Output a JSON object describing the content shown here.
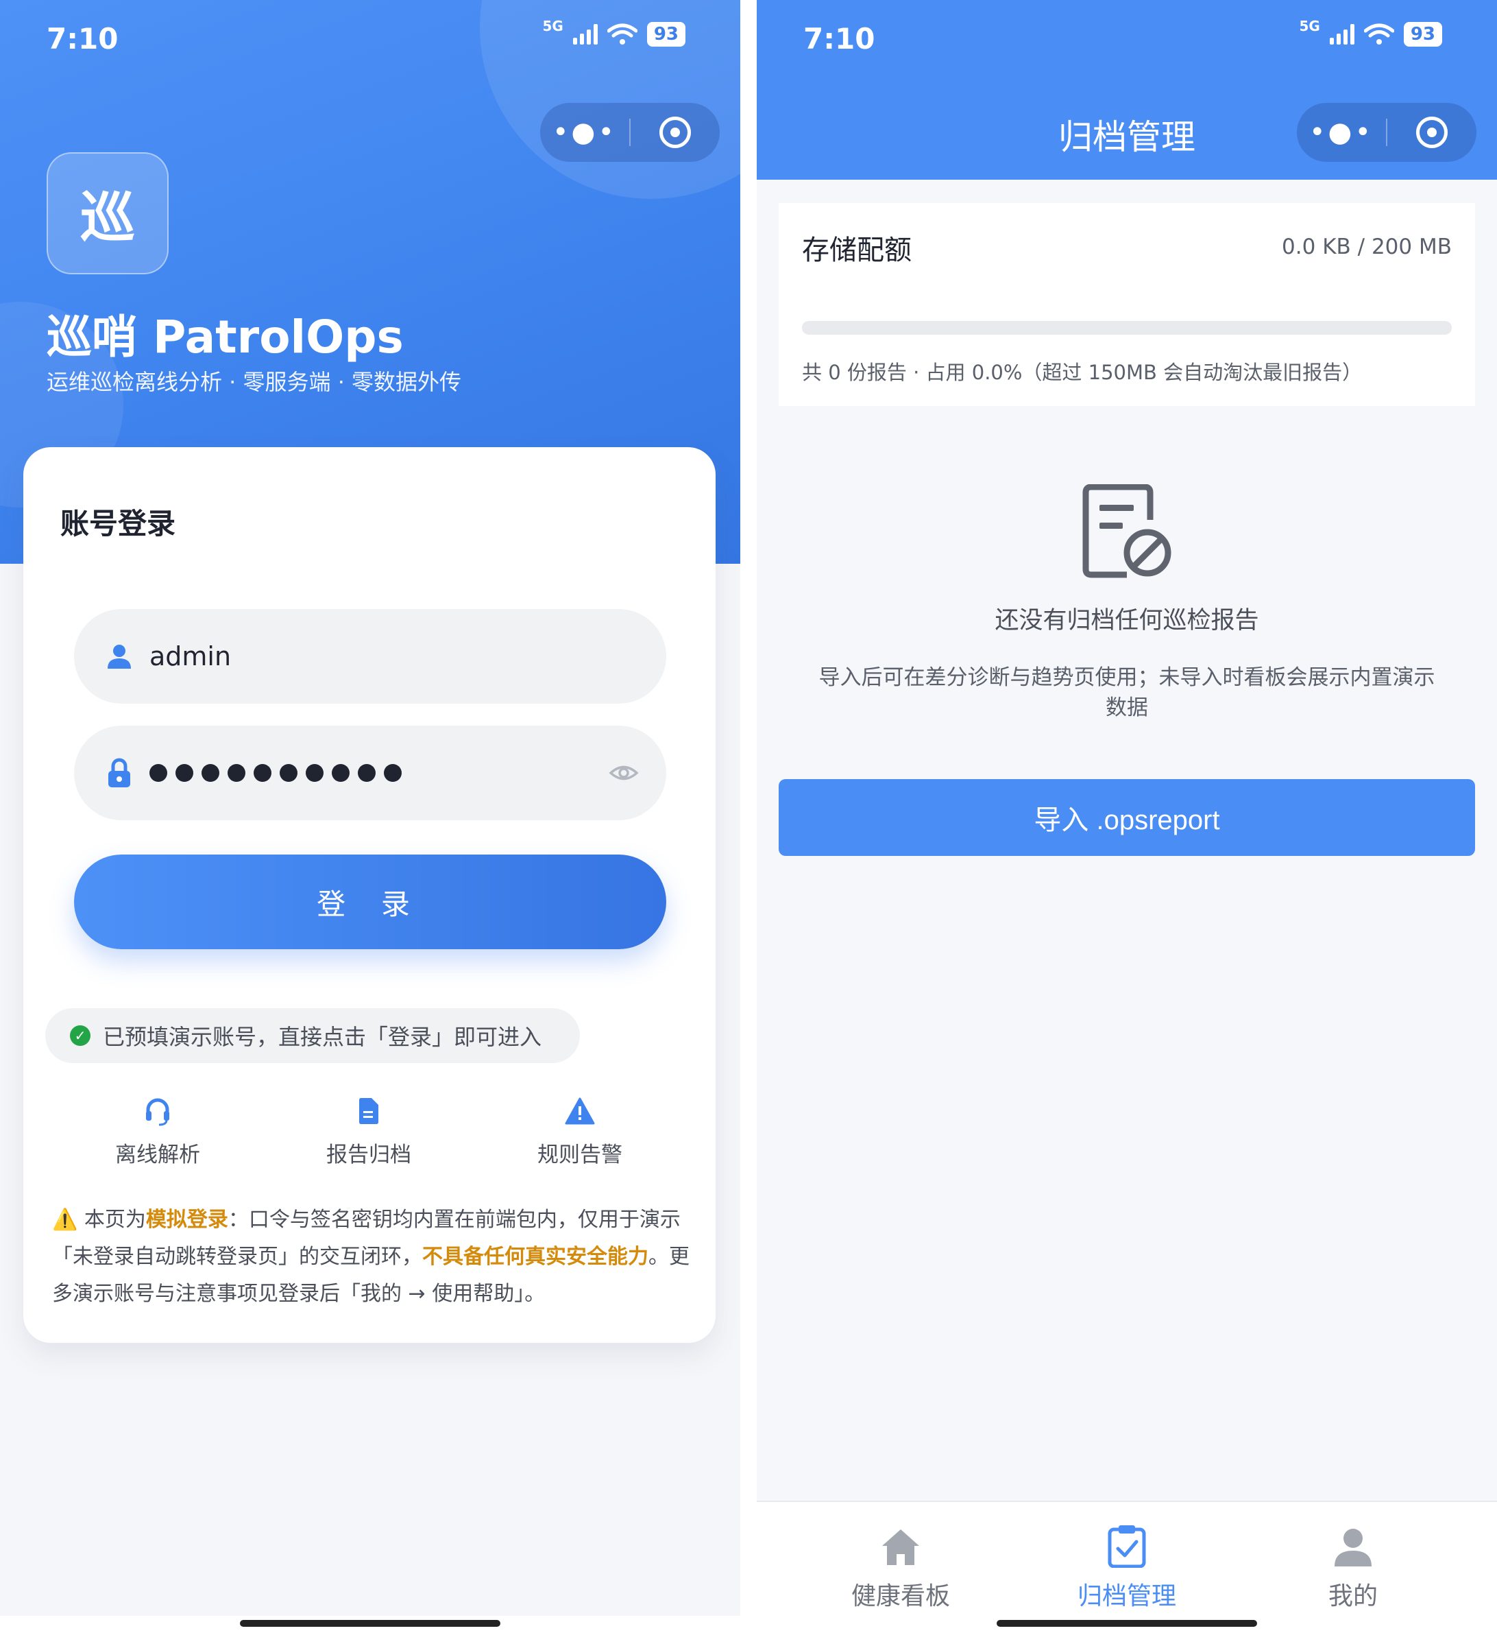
{
  "left": {
    "status": {
      "time": "7:10",
      "network": "5G",
      "battery": "93"
    },
    "capsule": {
      "more_icon": "more-dots-icon",
      "close_icon": "target-icon"
    },
    "logo_char": "巡",
    "brand": "巡哨 PatrolOps",
    "slogan": "运维巡检离线分析 · 零服务端 · 零数据外传",
    "card_title": "账号登录",
    "username": {
      "value": "admin",
      "icon": "user-icon"
    },
    "password": {
      "masked_count": 10,
      "icon": "lock-icon",
      "toggle_icon": "eye-icon"
    },
    "login_button": "登 录",
    "hint": "已预填演示账号，直接点击「登录」即可进入",
    "features": [
      {
        "label": "离线解析",
        "icon": "headset-icon"
      },
      {
        "label": "报告归档",
        "icon": "document-icon"
      },
      {
        "label": "规则告警",
        "icon": "warning-icon"
      }
    ],
    "notice": {
      "p1": "本页为",
      "b1": "模拟登录",
      "p2": "：口令与签名密钥均内置在前端包内，仅用于演示「未登录自动跳转登录页」的交互闭环，",
      "b2": "不具备任何真实安全能力",
      "p3": "。更多演示账号与注意事项见登录后「我的 → 使用帮助」。"
    }
  },
  "right": {
    "status": {
      "time": "7:10",
      "network": "5G",
      "battery": "93"
    },
    "nav_title": "归档管理",
    "quota": {
      "title": "存储配额",
      "size": "0.0 KB / 200 MB",
      "used_fraction": 0.0,
      "summary": "共 0 份报告 · 占用 0.0%（超过 150MB 会自动淘汰最旧报告）"
    },
    "empty": {
      "icon": "document-forbidden-icon",
      "title": "还没有归档任何巡检报告",
      "desc": "导入后可在差分诊断与趋势页使用；未导入时看板会展示内置演示数据"
    },
    "import_button": "导入 .opsreport",
    "tabs": [
      {
        "label": "健康看板",
        "icon": "home-icon",
        "active": false
      },
      {
        "label": "归档管理",
        "icon": "clipboard-check-icon",
        "active": true
      },
      {
        "label": "我的",
        "icon": "person-icon",
        "active": false
      }
    ],
    "colors": {
      "primary": "#4a8ef5",
      "text": "#1f2430",
      "warning": "#d48a0b",
      "success": "#22a447"
    }
  }
}
